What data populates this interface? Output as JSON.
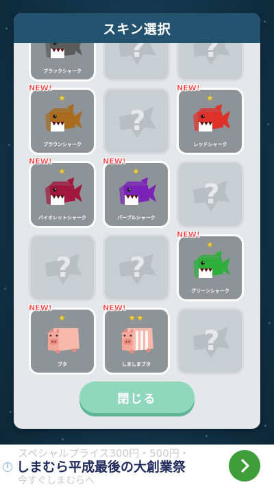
{
  "dialog": {
    "title": "スキン選択",
    "close_label": "閉じる"
  },
  "colors": {
    "header": "#24536f",
    "close_button": "#8fd8bd",
    "new_badge": "#ff3b3b",
    "star": "#f3d23a"
  },
  "skins": [
    {
      "name": "ブラックシャーク",
      "state": "unlocked",
      "new": false,
      "stars": 0,
      "color": "#5a5a5a",
      "kind": "shark"
    },
    {
      "name": "",
      "state": "locked",
      "new": false,
      "stars": 0,
      "kind": "locked"
    },
    {
      "name": "",
      "state": "locked",
      "new": false,
      "stars": 0,
      "kind": "locked"
    },
    {
      "name": "ブラウンシャーク",
      "state": "unlocked",
      "new": true,
      "stars": 1,
      "color": "#a86b1f",
      "kind": "shark"
    },
    {
      "name": "",
      "state": "locked",
      "new": false,
      "stars": 0,
      "kind": "locked"
    },
    {
      "name": "レッドシャーク",
      "state": "unlocked",
      "new": true,
      "stars": 1,
      "color": "#e0302a",
      "kind": "shark"
    },
    {
      "name": "バイオレットシャーク",
      "state": "unlocked",
      "new": true,
      "stars": 1,
      "color": "#a0183e",
      "kind": "shark"
    },
    {
      "name": "パープルシャーク",
      "state": "unlocked",
      "new": true,
      "stars": 1,
      "color": "#7a23b8",
      "kind": "shark"
    },
    {
      "name": "",
      "state": "locked",
      "new": false,
      "stars": 0,
      "kind": "locked"
    },
    {
      "name": "",
      "state": "locked",
      "new": false,
      "stars": 0,
      "kind": "locked"
    },
    {
      "name": "",
      "state": "locked",
      "new": false,
      "stars": 0,
      "kind": "locked"
    },
    {
      "name": "グリーンシャーク",
      "state": "unlocked",
      "new": true,
      "stars": 1,
      "color": "#2fae3c",
      "kind": "shark"
    },
    {
      "name": "ブタ",
      "state": "unlocked",
      "new": true,
      "stars": 1,
      "color": "#f2a79a",
      "kind": "pig"
    },
    {
      "name": "しましまブタ",
      "state": "unlocked",
      "new": true,
      "stars": 2,
      "color": "#f2a79a",
      "kind": "striped-pig"
    },
    {
      "name": "",
      "state": "locked",
      "new": false,
      "stars": 0,
      "kind": "locked"
    }
  ],
  "new_badge_text": "NEW!",
  "star_glyph": "★",
  "ad": {
    "line1": "スペシャルプライス300円・500円・",
    "line2": "しまむら平成最後の大創業祭",
    "line3": "今すぐしまむらへ",
    "info_glyph": "i",
    "arrow_icon": "chevron-right-icon"
  }
}
